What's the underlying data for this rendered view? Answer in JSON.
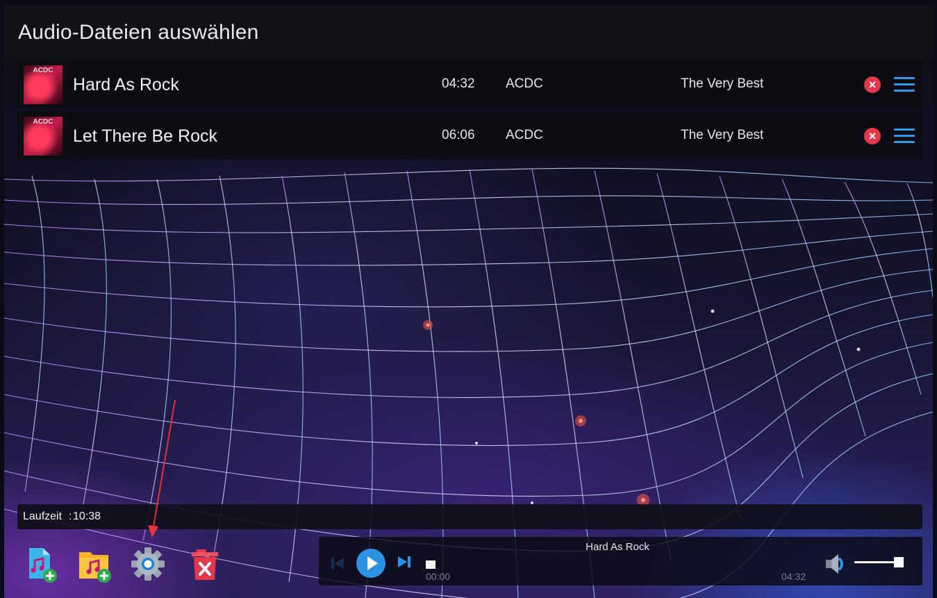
{
  "header": {
    "title": "Audio-Dateien auswählen"
  },
  "tracks": [
    {
      "title": "Hard As Rock",
      "duration": "04:32",
      "artist": "ACDC",
      "album": "The Very Best",
      "cover_text": "ACDC"
    },
    {
      "title": "Let There Be Rock",
      "duration": "06:06",
      "artist": "ACDC",
      "album": "The Very Best",
      "cover_text": "ACDC"
    }
  ],
  "status": {
    "runtime_label": "Laufzeit",
    "runtime_sep": ":",
    "runtime_value": "10:38"
  },
  "toolbar": {
    "icons": [
      "add-audio-file-icon",
      "add-folder-icon",
      "settings-gear-icon",
      "delete-list-icon"
    ]
  },
  "player": {
    "now_playing": "Hard As Rock",
    "time_current": "00:00",
    "time_total": "04:32",
    "progress": 0,
    "volume": 0.92
  },
  "colors": {
    "accent_blue": "#2a93e4",
    "remove_red": "#e3384a",
    "annotation_red": "#e5323b",
    "folder_yellow": "#f4b426",
    "file_cyan": "#3bb5e8"
  }
}
